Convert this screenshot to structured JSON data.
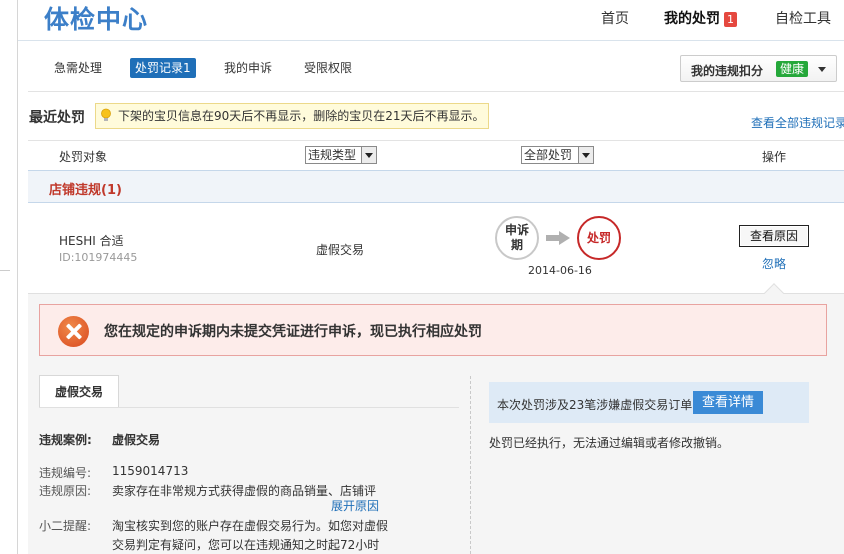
{
  "header": {
    "brand": "体检中心",
    "nav": {
      "home": "首页",
      "my_penalty": "我的处罚",
      "my_penalty_count": "1",
      "self_check": "自检工具"
    }
  },
  "tabs": {
    "urgent": "急需处理",
    "records": "处罚记录1",
    "appeal": "我的申诉",
    "restrict": "受限权限"
  },
  "score": {
    "label": "我的违规扣分",
    "status": "健康"
  },
  "recent": {
    "title": "最近处罚",
    "notice": "下架的宝贝信息在90天后不再显示，删除的宝贝在21天后不再显示。",
    "view_all": "查看全部违规记录"
  },
  "table": {
    "col_object": "处罚对象",
    "col_type_select": "违规类型",
    "col_all_select": "全部处罚",
    "col_op": "操作"
  },
  "group": {
    "title": "店铺违规(1)"
  },
  "row": {
    "shop": "HESHI 合适",
    "id": "ID:101974445",
    "type": "虚假交易",
    "step_appeal_line1": "申诉",
    "step_appeal_line2": "期",
    "step_penalty": "处罚",
    "date": "2014-06-16",
    "btn_reason": "查看原因",
    "ignore": "忽略"
  },
  "detail": {
    "alert": "您在规定的申诉期内未提交凭证进行申诉，现已执行相应处罚",
    "case_tab": "虚假交易",
    "case_label": "违规案例:",
    "case_value": "虚假交易",
    "no_label": "违规编号:",
    "no_value": "1159014713",
    "reason_label": "违规原因:",
    "reason_value": "卖家存在非常规方式获得虚假的商品销量、店铺评",
    "expand": "展开原因",
    "tip_label": "小二提醒:",
    "tip_line1": "淘宝核实到您的账户存在虚假交易行为。如您对虚假",
    "tip_line2": "交易判定有疑问，您可以在违规通知之时起72小时",
    "info_text": "本次处罚涉及23笔涉嫌虚假交易订单",
    "btn_detail": "查看详情",
    "executed": "处罚已经执行，无法通过编辑或者修改撤销。"
  },
  "colors": {
    "brand": "#3c7fc8",
    "link": "#1f6fb8",
    "danger": "#c62828",
    "healthy": "#25a83a"
  }
}
